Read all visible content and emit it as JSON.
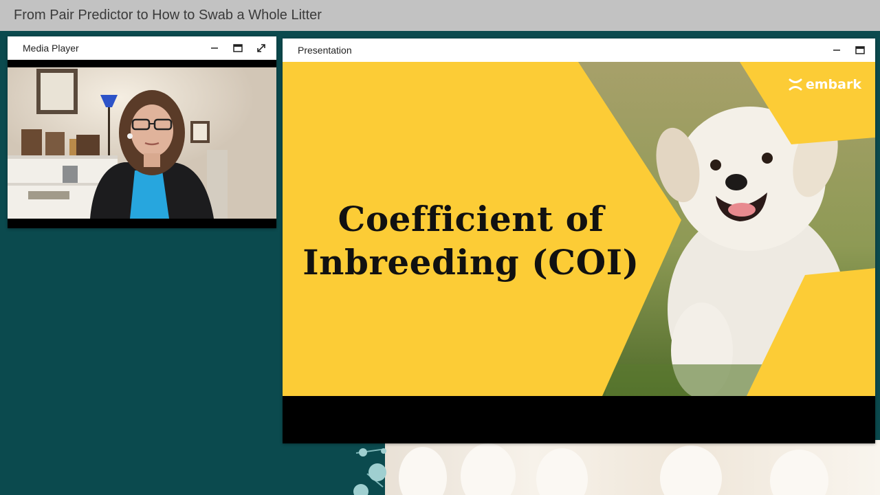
{
  "app": {
    "title": "From Pair Predictor to How to Swab a Whole Litter"
  },
  "media_player": {
    "title": "Media Player",
    "controls": [
      "minimize-icon",
      "maximize-icon",
      "expand-icon"
    ]
  },
  "presentation": {
    "title": "Presentation",
    "controls": [
      "minimize-icon",
      "maximize-icon"
    ],
    "slide": {
      "title_line1": "Coefficient of",
      "title_line2": "Inbreeding (COI)",
      "logo_text": "embark"
    }
  },
  "colors": {
    "background": "#0b4a4e",
    "title_bar": "#c2c2c2",
    "slide_yellow": "#fccc36",
    "shirt_blue": "#27a6de"
  }
}
